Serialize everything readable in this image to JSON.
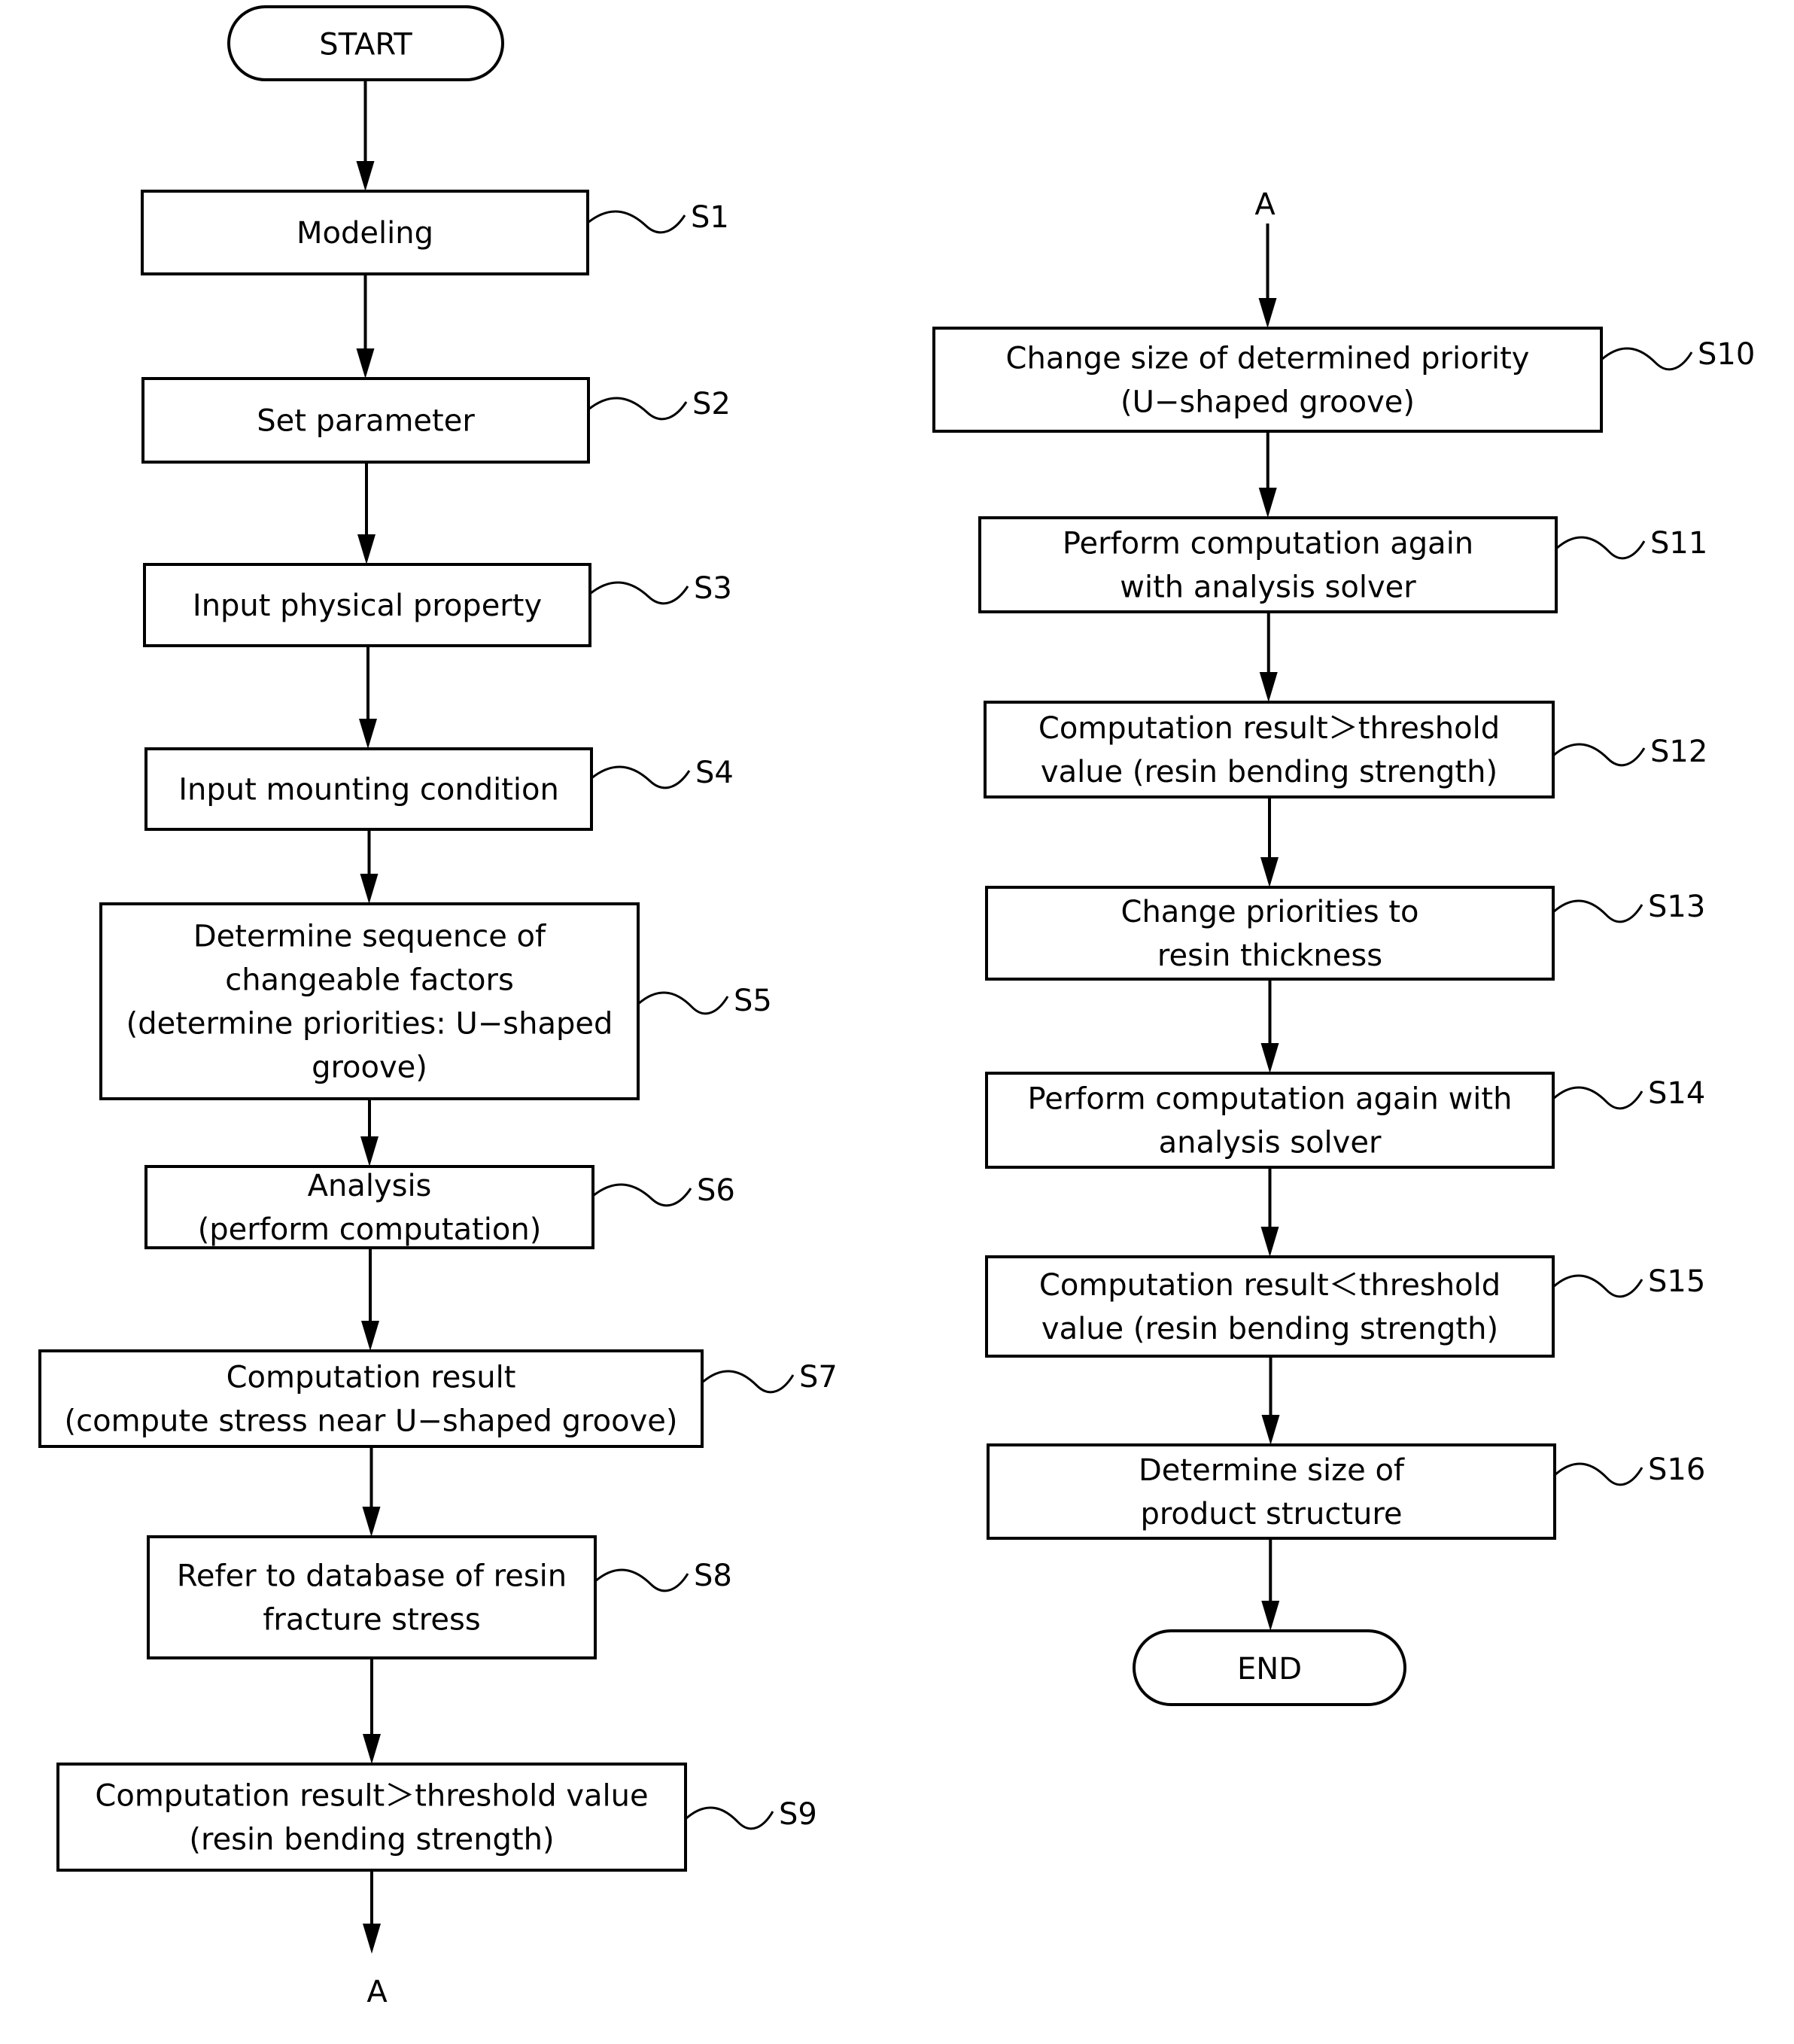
{
  "diagram": {
    "type": "flowchart",
    "terminals": {
      "start": "START",
      "end": "END"
    },
    "connector_label": "A",
    "steps": [
      {
        "id": "S1",
        "lines": [
          "Modeling"
        ]
      },
      {
        "id": "S2",
        "lines": [
          "Set parameter"
        ]
      },
      {
        "id": "S3",
        "lines": [
          "Input physical property"
        ]
      },
      {
        "id": "S4",
        "lines": [
          "Input mounting condition"
        ]
      },
      {
        "id": "S5",
        "lines": [
          "Determine sequence of",
          "changeable factors",
          "(determine priorities: U−shaped",
          "groove)"
        ]
      },
      {
        "id": "S6",
        "lines": [
          "Analysis",
          "(perform computation)"
        ]
      },
      {
        "id": "S7",
        "lines": [
          "Computation result",
          "(compute stress near U−shaped groove)"
        ]
      },
      {
        "id": "S8",
        "lines": [
          "Refer to database of resin",
          "fracture stress"
        ]
      },
      {
        "id": "S9",
        "lines": [
          "Computation result＞threshold value",
          "(resin bending strength)"
        ]
      },
      {
        "id": "S10",
        "lines": [
          "Change size of determined priority",
          "(U−shaped groove)"
        ]
      },
      {
        "id": "S11",
        "lines": [
          "Perform computation again",
          "with analysis solver"
        ]
      },
      {
        "id": "S12",
        "lines": [
          "Computation result＞threshold",
          "value (resin bending strength)"
        ]
      },
      {
        "id": "S13",
        "lines": [
          "Change priorities to",
          "resin thickness"
        ]
      },
      {
        "id": "S14",
        "lines": [
          "Perform computation again with",
          "analysis solver"
        ]
      },
      {
        "id": "S15",
        "lines": [
          "Computation result＜threshold",
          "value (resin bending strength)"
        ]
      },
      {
        "id": "S16",
        "lines": [
          "Determine size of",
          "product structure"
        ]
      }
    ],
    "edges": [
      [
        "START",
        "S1"
      ],
      [
        "S1",
        "S2"
      ],
      [
        "S2",
        "S3"
      ],
      [
        "S3",
        "S4"
      ],
      [
        "S4",
        "S5"
      ],
      [
        "S5",
        "S6"
      ],
      [
        "S6",
        "S7"
      ],
      [
        "S7",
        "S8"
      ],
      [
        "S8",
        "S9"
      ],
      [
        "S9",
        "A"
      ],
      [
        "A",
        "S10"
      ],
      [
        "S10",
        "S11"
      ],
      [
        "S11",
        "S12"
      ],
      [
        "S12",
        "S13"
      ],
      [
        "S13",
        "S14"
      ],
      [
        "S14",
        "S15"
      ],
      [
        "S15",
        "S16"
      ],
      [
        "S16",
        "END"
      ]
    ]
  }
}
